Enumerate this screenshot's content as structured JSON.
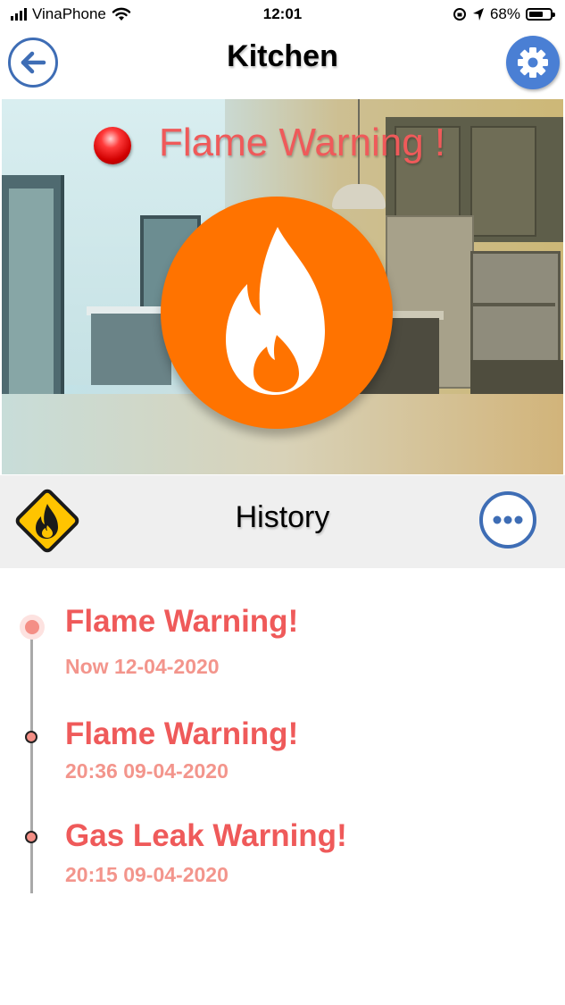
{
  "status_bar": {
    "carrier": "VinaPhone",
    "time": "12:01",
    "battery_percent": "68%",
    "battery_level": 0.68
  },
  "header": {
    "title": "Kitchen",
    "back_icon": "arrow-left-icon",
    "settings_icon": "gear-icon"
  },
  "alert": {
    "title": "Flame Warning !",
    "indicator_icon": "red-alert-dot",
    "main_icon": "flame-icon",
    "accent_color": "#ff7300",
    "text_color": "#ef5a5a"
  },
  "history": {
    "title": "History",
    "left_icon": "hazard-flame-icon",
    "more_icon": "more-dots-icon",
    "items": [
      {
        "title": "Flame Warning!",
        "time": "Now 12-04-2020"
      },
      {
        "title": "Flame Warning!",
        "time": "20:36 09-04-2020"
      },
      {
        "title": "Gas Leak Warning!",
        "time": "20:15 09-04-2020"
      }
    ]
  }
}
